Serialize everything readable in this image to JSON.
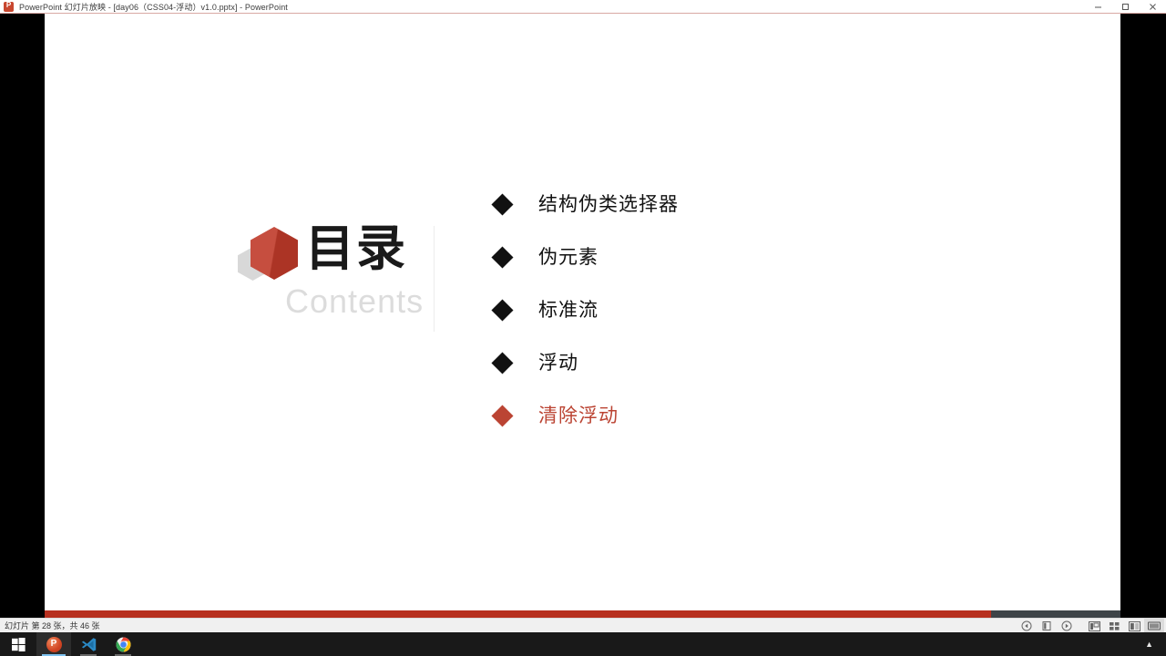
{
  "window": {
    "title": "PowerPoint 幻灯片放映 - [day06（CSS04-浮动）v1.0.pptx] - PowerPoint",
    "app_icon": "powerpoint-icon",
    "controls": {
      "minimize": "minimize-icon",
      "restore": "restore-icon",
      "close": "close-icon"
    }
  },
  "slide": {
    "logo": {
      "title_cn": "目录",
      "title_en": "Contents",
      "hex_primary_color": "#bf3a29",
      "hex_secondary_color": "#d8d8d8"
    },
    "contents": [
      {
        "label": "结构伪类选择器",
        "active": false
      },
      {
        "label": "伪元素",
        "active": false
      },
      {
        "label": "标准流",
        "active": false
      },
      {
        "label": "浮动",
        "active": false
      },
      {
        "label": "清除浮动",
        "active": true
      }
    ],
    "accent_color": "#bb4433",
    "text_color": "#111111",
    "background_color": "#ffffff"
  },
  "progress": {
    "percent": 88,
    "fill_color": "#b7301f",
    "track_color": "#3e4448"
  },
  "statusbar": {
    "text": "幻灯片 第 28 张，共 46 张",
    "icons": [
      "previous-slide-icon",
      "pen-pointer-icon",
      "next-slide-icon",
      "normal-view-icon",
      "slide-sorter-icon",
      "reading-view-icon",
      "slideshow-view-icon"
    ]
  },
  "taskbar": {
    "start": "windows-start-icon",
    "apps": [
      {
        "name": "powerpoint-taskbar-icon",
        "state": "active"
      },
      {
        "name": "vscode-taskbar-icon",
        "state": "open"
      },
      {
        "name": "chrome-taskbar-icon",
        "state": "open"
      }
    ],
    "tray_chevron": "▲"
  }
}
